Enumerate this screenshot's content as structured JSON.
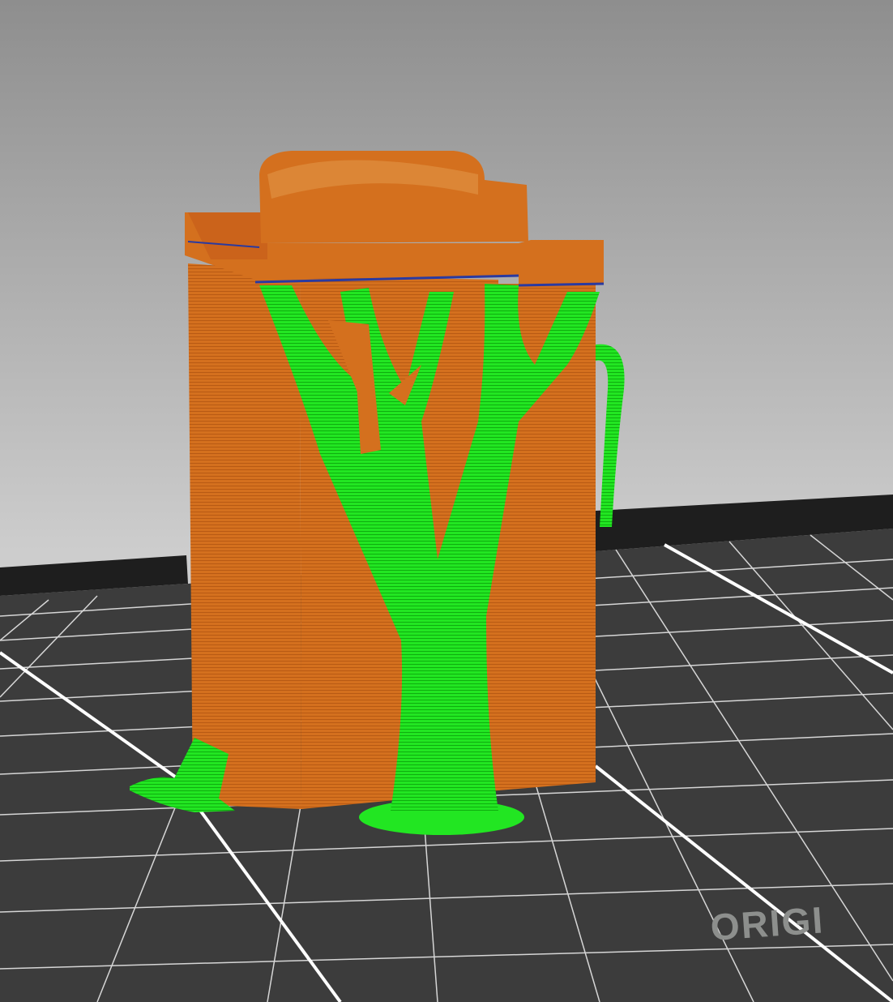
{
  "viewport": {
    "view": "3D preview",
    "bed_logo": "ORIGI"
  },
  "colors": {
    "background_top": "#8e8e8e",
    "background_bottom": "#cdcdcd",
    "bed": "#3c3c3c",
    "grid_line": "#d8d8d8",
    "perimeter": "#d4701e",
    "support": "#1ee61e"
  }
}
